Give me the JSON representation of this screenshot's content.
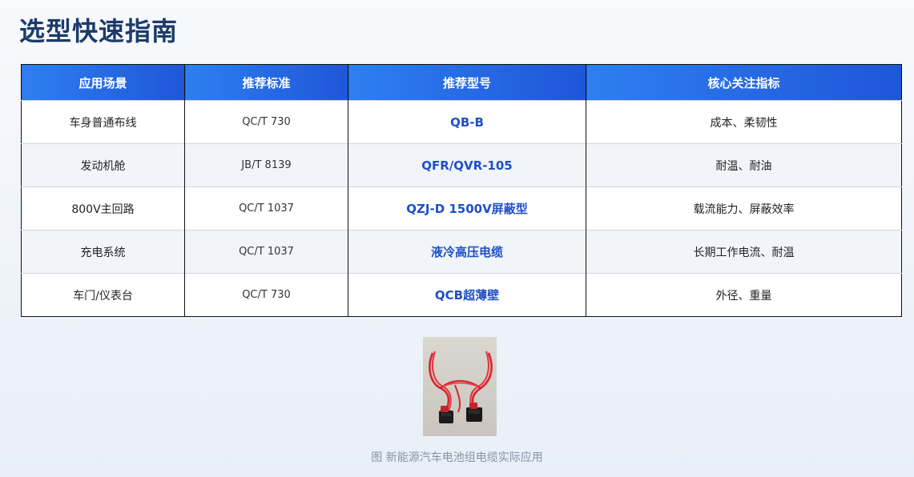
{
  "title": "选型快速指南",
  "table": {
    "headers": [
      "应用场景",
      "推荐标准",
      "推荐型号",
      "核心关注指标"
    ],
    "rows": [
      {
        "scene": "车身普通布线",
        "standard": "QC/T 730",
        "model": "QB-B",
        "metric": "成本、柔韧性"
      },
      {
        "scene": "发动机舱",
        "standard": "JB/T 8139",
        "model": "QFR/QVR-105",
        "metric": "耐温、耐油"
      },
      {
        "scene": "800V主回路",
        "standard": "QC/T 1037",
        "model": "QZJ-D 1500V屏蔽型",
        "metric": "载流能力、屏蔽效率"
      },
      {
        "scene": "充电系统",
        "standard": "QC/T 1037",
        "model": "液冷高压电缆",
        "metric": "长期工作电流、耐温"
      },
      {
        "scene": "车门/仪表台",
        "standard": "QC/T 730",
        "model": "QCB超薄壁",
        "metric": "外径、重量"
      }
    ]
  },
  "figure": {
    "caption": "图 新能源汽车电池组电缆实际应用"
  },
  "colors": {
    "title": "#1c3b6b",
    "header_gradient_start": "#2e7ff0",
    "header_gradient_end": "#1f56d9",
    "model_text": "#1f4fc8",
    "cable_red": "#e0303a"
  }
}
